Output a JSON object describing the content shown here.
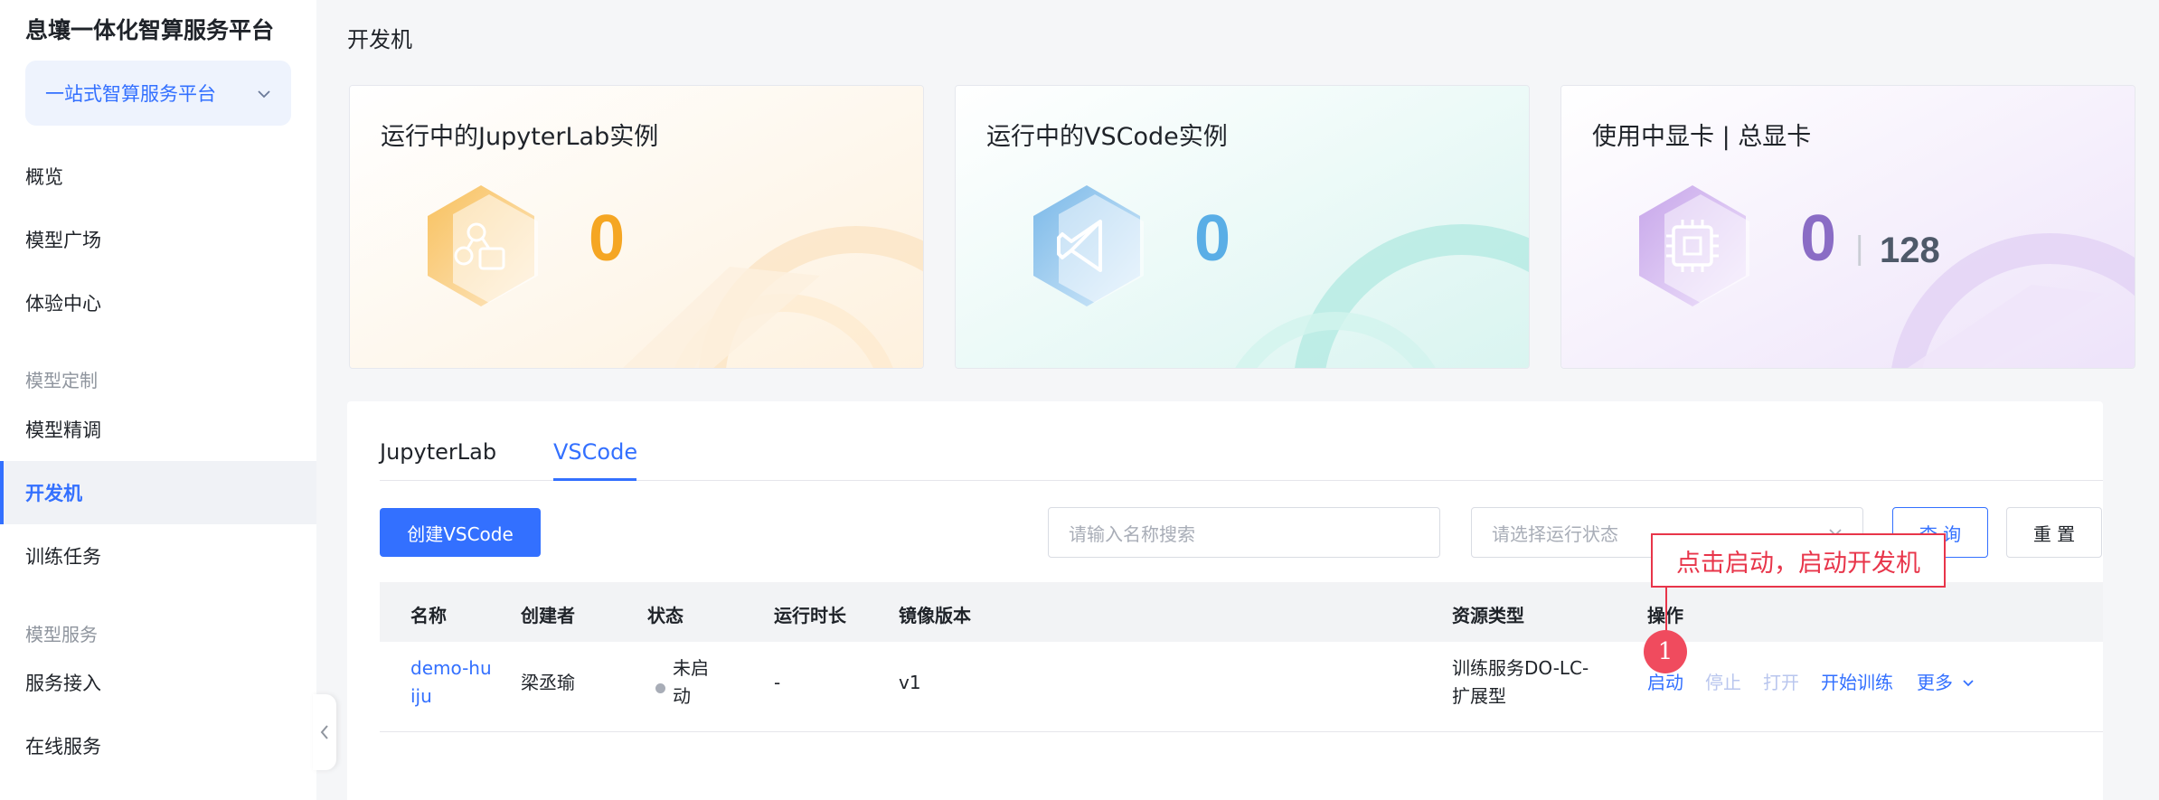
{
  "sidebar": {
    "brand": "息壤一体化智算服务平台",
    "platform": "一站式智算服务平台",
    "items": [
      {
        "label": "概览"
      },
      {
        "label": "模型广场"
      },
      {
        "label": "体验中心"
      },
      {
        "label": "模型精调"
      },
      {
        "label": "开发机"
      },
      {
        "label": "训练任务"
      },
      {
        "label": "服务接入"
      },
      {
        "label": "在线服务"
      }
    ],
    "groups": [
      "模型定制",
      "模型服务"
    ]
  },
  "page": {
    "title": "开发机"
  },
  "cards": [
    {
      "title": "运行中的JupyterLab实例",
      "value": "0",
      "color": "#f5a623"
    },
    {
      "title": "运行中的VSCode实例",
      "value": "0",
      "color": "#5aaee6"
    },
    {
      "title": "使用中显卡 | 总显卡",
      "value": "0",
      "separator": "|",
      "total": "128",
      "color": "#8a6cc5"
    }
  ],
  "tabs": [
    {
      "label": "JupyterLab",
      "active": false
    },
    {
      "label": "VSCode",
      "active": true
    }
  ],
  "toolbar": {
    "create_label": "创建VSCode",
    "search_placeholder": "请输入名称搜索",
    "status_placeholder": "请选择运行状态",
    "query_label": "查 询",
    "reset_label": "重 置"
  },
  "table": {
    "headers": [
      "名称",
      "创建者",
      "状态",
      "运行时长",
      "镜像版本",
      "资源类型",
      "操作"
    ],
    "rows": [
      {
        "name_line1": "demo-hu",
        "name_line2": "iju",
        "creator": "梁丞瑜",
        "status_line1": "未启",
        "status_line2": "动",
        "duration": "-",
        "image": "v1",
        "resource_line1": "训练服务DO-LC-",
        "resource_line2": "扩展型",
        "actions": {
          "start": "启动",
          "stop": "停止",
          "open": "打开",
          "train": "开始训练",
          "more": "更多"
        }
      }
    ]
  },
  "annotation": {
    "text": "点击启动，启动开发机",
    "marker": "1"
  }
}
